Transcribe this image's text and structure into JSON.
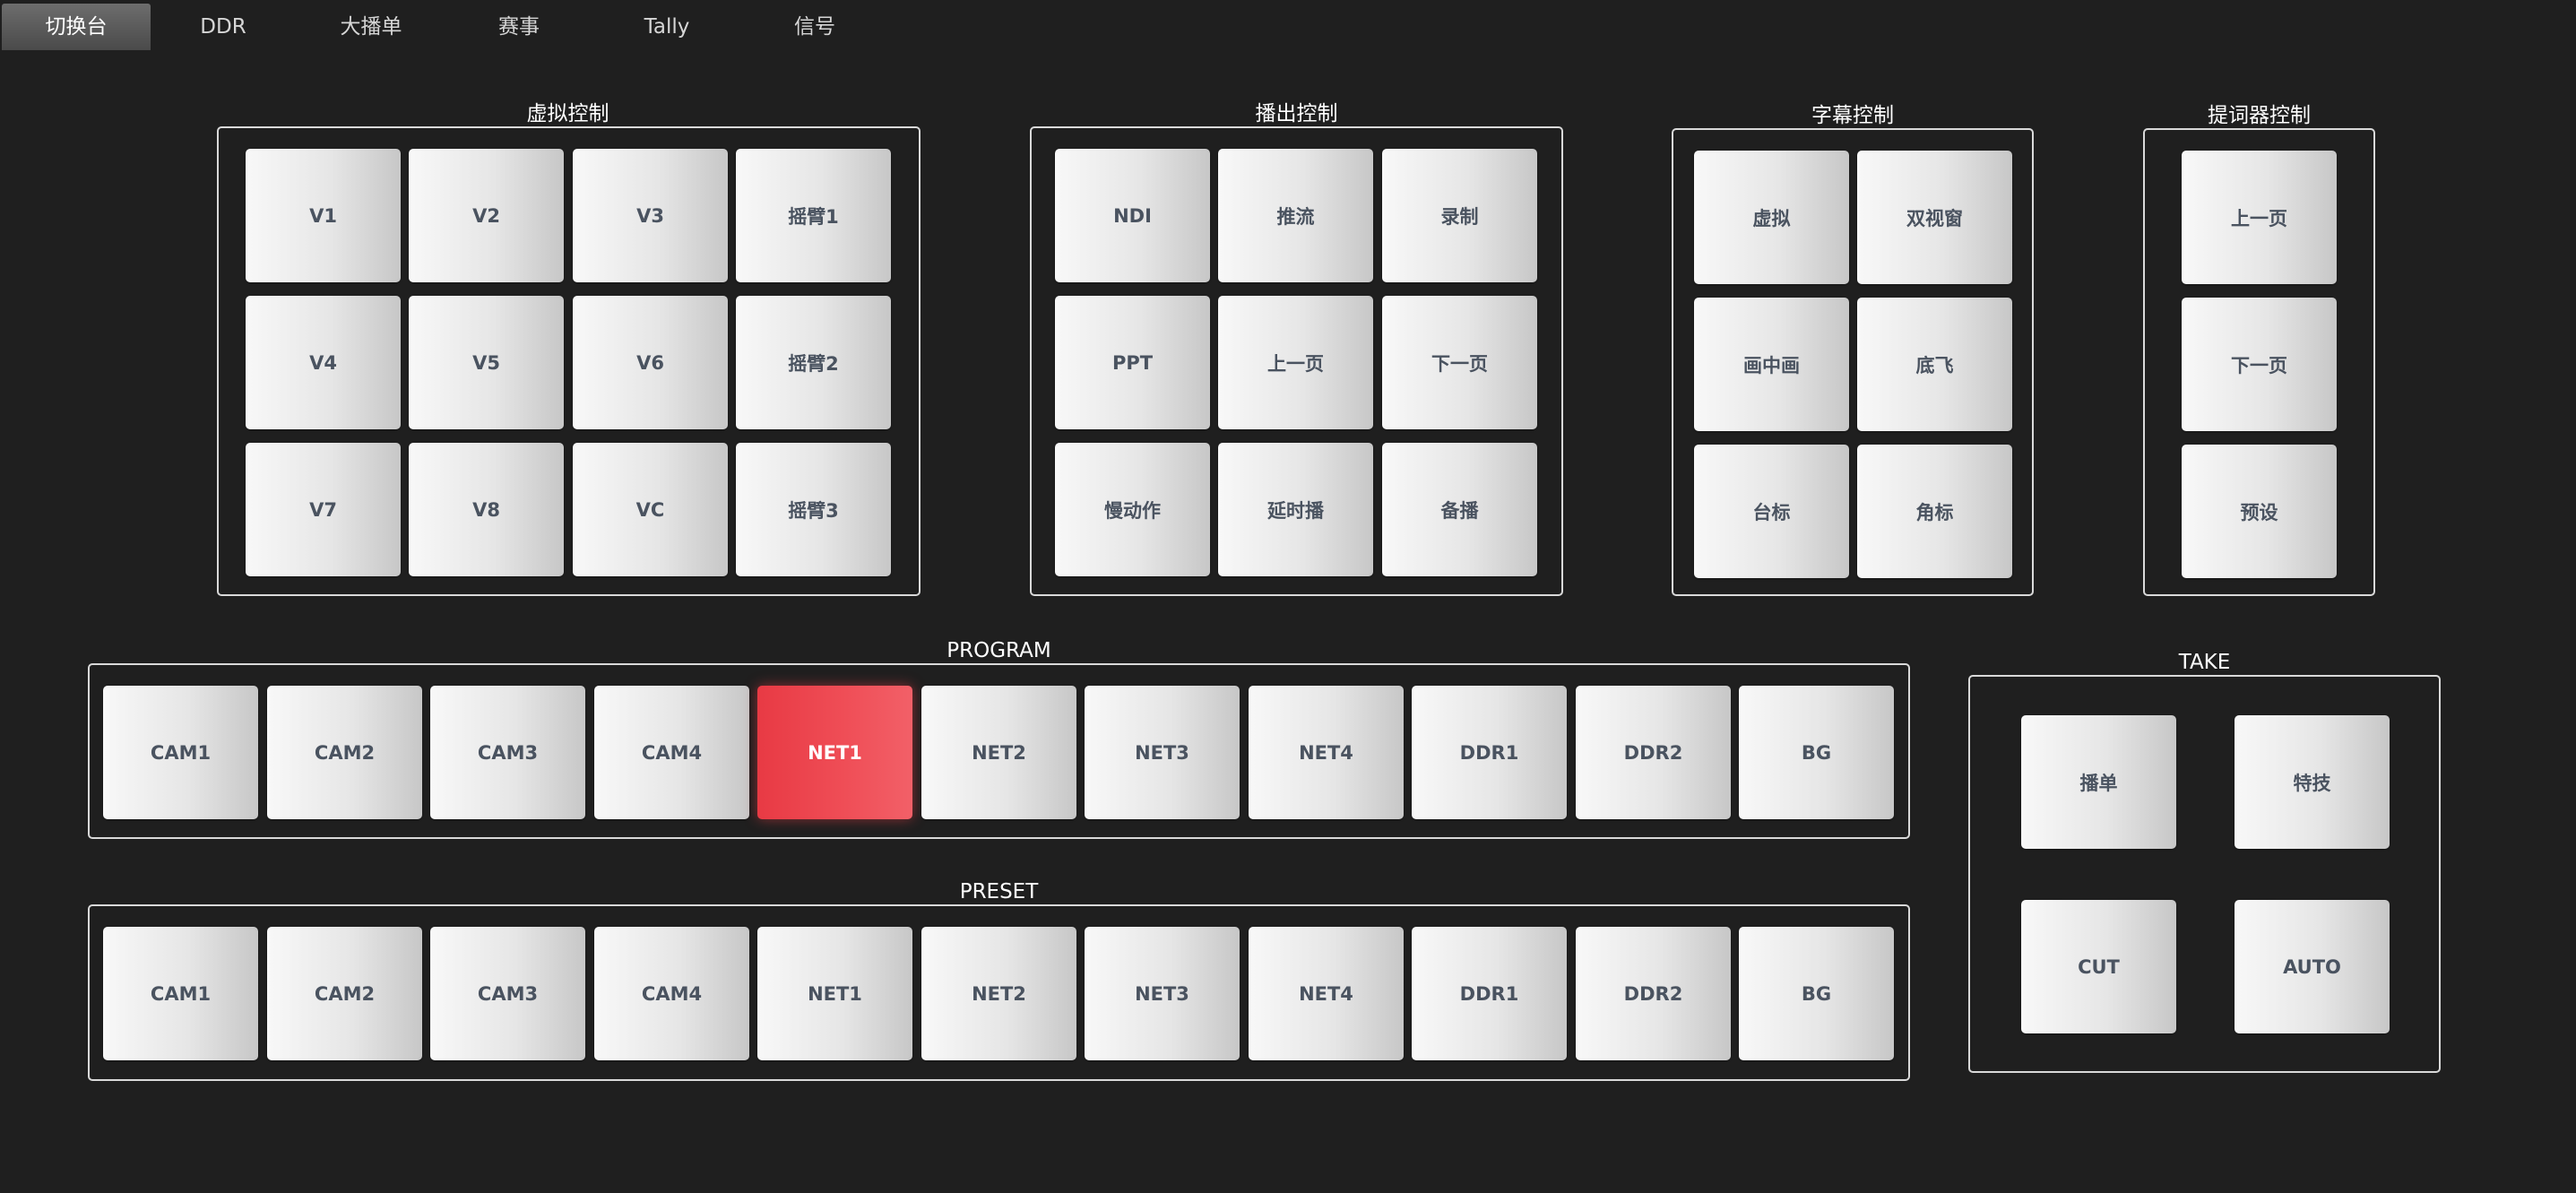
{
  "tabs": [
    "切换台",
    "DDR",
    "大播单",
    "赛事",
    "Tally",
    "信号"
  ],
  "active_tab": "切换台",
  "colors": {
    "background": "#1f1f1f",
    "button": "#e6e6e6",
    "button_text": "#4a5360",
    "program_live": "#ef4d56",
    "border": "#d9d9d9"
  },
  "virtual_control": {
    "title": "虚拟控制",
    "buttons": [
      "V1",
      "V2",
      "V3",
      "摇臂1",
      "V4",
      "V5",
      "V6",
      "摇臂2",
      "V7",
      "V8",
      "VC",
      "摇臂3"
    ]
  },
  "playout_control": {
    "title": "播出控制",
    "buttons": [
      "NDI",
      "推流",
      "录制",
      "PPT",
      "上一页",
      "下一页",
      "慢动作",
      "延时播",
      "备播"
    ]
  },
  "subtitle_control": {
    "title": "字幕控制",
    "buttons": [
      "虚拟",
      "双视窗",
      "画中画",
      "底飞",
      "台标",
      "角标"
    ]
  },
  "prompter_control": {
    "title": "提词器控制",
    "buttons": [
      "上一页",
      "下一页",
      "预设"
    ]
  },
  "program": {
    "title": "PROGRAM",
    "sources": [
      "CAM1",
      "CAM2",
      "CAM3",
      "CAM4",
      "NET1",
      "NET2",
      "NET3",
      "NET4",
      "DDR1",
      "DDR2",
      "BG"
    ],
    "active": "NET1"
  },
  "preset": {
    "title": "PRESET",
    "sources": [
      "CAM1",
      "CAM2",
      "CAM3",
      "CAM4",
      "NET1",
      "NET2",
      "NET3",
      "NET4",
      "DDR1",
      "DDR2",
      "BG"
    ]
  },
  "take": {
    "title": "TAKE",
    "buttons": [
      "播单",
      "特技",
      "CUT",
      "AUTO"
    ]
  }
}
